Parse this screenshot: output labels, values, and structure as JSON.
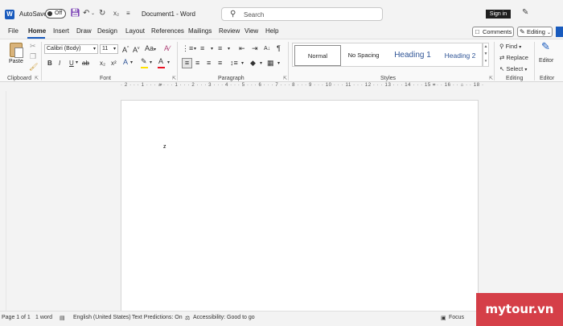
{
  "titlebar": {
    "autosave_label": "AutoSave",
    "autosave_state": "Off",
    "document_title": "Document1 - Word",
    "search_placeholder": "Search",
    "signin_label": "Sign in"
  },
  "tabs": [
    "File",
    "Home",
    "Insert",
    "Draw",
    "Design",
    "Layout",
    "References",
    "Mailings",
    "Review",
    "View",
    "Help"
  ],
  "active_tab": "Home",
  "top_right": {
    "comments_label": "Comments",
    "editing_label": "Editing"
  },
  "ribbon": {
    "clipboard": {
      "paste_label": "Paste",
      "group_label": "Clipboard"
    },
    "font": {
      "font_name": "Calibri (Body)",
      "font_size": "11",
      "group_label": "Font"
    },
    "paragraph": {
      "group_label": "Paragraph"
    },
    "styles": {
      "items": [
        "Normal",
        "No Spacing",
        "Heading 1",
        "Heading 2"
      ],
      "group_label": "Styles"
    },
    "editing": {
      "find_label": "Find",
      "replace_label": "Replace",
      "select_label": "Select",
      "group_label": "Editing"
    },
    "editor": {
      "label": "Editor",
      "group_label": "Editor"
    }
  },
  "ruler": {
    "text": "· 2 · · · 1 · · · ⌂ · · · 1 · · · 2 · · · 3 · · · 4 · · · 5 · · · 6 · · · 7 · · · 8 · · · 9 · · · 10 · · · 11 · · · 12 · · · 13 · · · 14 · · · 15 · · · 16 · · ⌂ · · 18 ·"
  },
  "document": {
    "content": "z"
  },
  "statusbar": {
    "page": "Page 1 of 1",
    "words": "1 word",
    "language": "English (United States)",
    "text_predictions": "Text Predictions: On",
    "accessibility": "Accessibility: Good to go",
    "focus": "Focus"
  },
  "watermark": {
    "text": "mytour.vn"
  },
  "colors": {
    "accent": "#185abd",
    "highlight": "#ffe100",
    "font_color": "#e81123",
    "heading": "#2f5496",
    "watermark": "#d2303a"
  }
}
